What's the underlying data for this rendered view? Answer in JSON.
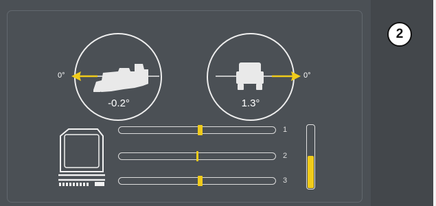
{
  "step": {
    "number": "2"
  },
  "pitch": {
    "value": "-0.2°",
    "reference": "0°",
    "icon": "locomotive-side-icon"
  },
  "roll": {
    "value": "1.3°",
    "reference": "0°",
    "icon": "vehicle-front-icon"
  },
  "sensors": [
    {
      "number": "1",
      "position": 0.52
    },
    {
      "number": "2",
      "position": 0.5
    },
    {
      "number": "3",
      "position": 0.52
    }
  ],
  "level": {
    "fill": 0.52
  },
  "colors": {
    "accent": "#f0cb1a",
    "background": "#4b5055",
    "outline": "#eeeeee"
  },
  "icons": {
    "machine": "machine-front-icon"
  }
}
